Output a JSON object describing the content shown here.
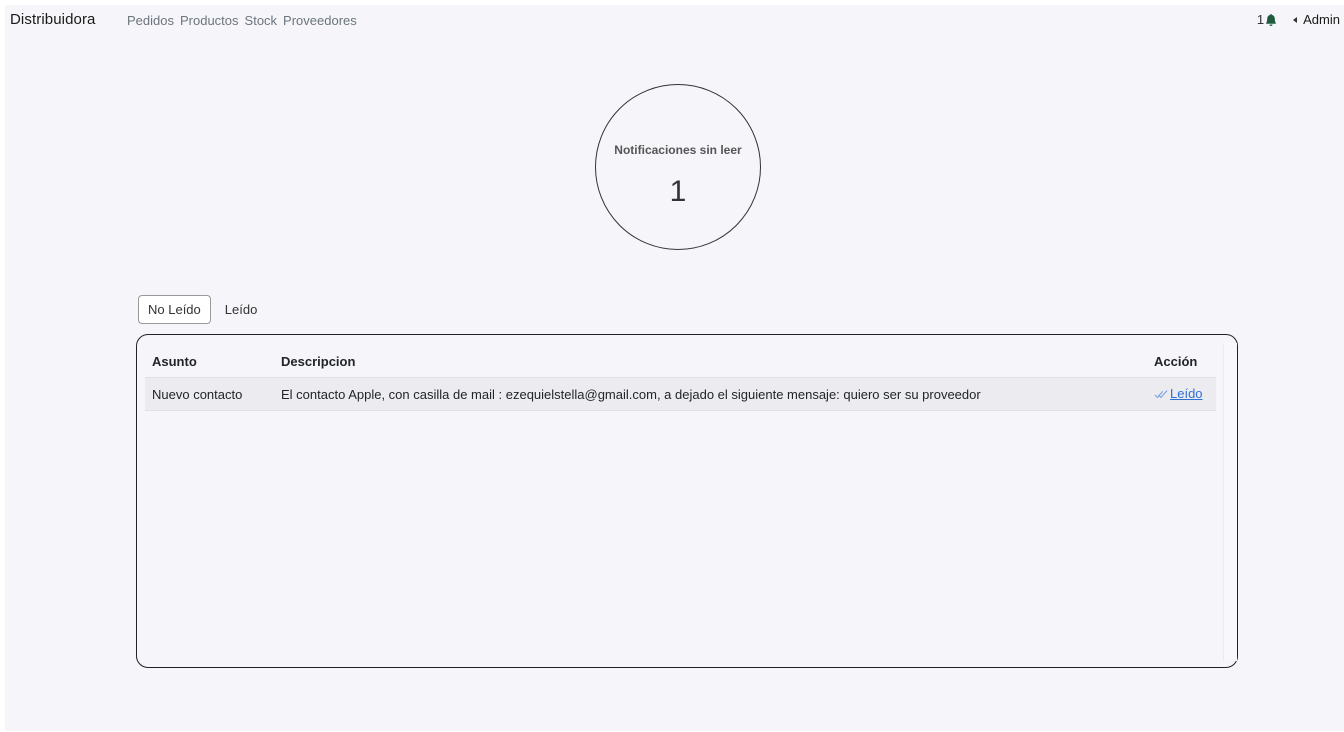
{
  "navbar": {
    "brand": "Distribuidora",
    "links": [
      "Pedidos",
      "Productos",
      "Stock",
      "Proveedores"
    ],
    "notification_count": "1",
    "notification_icon": "bell-icon",
    "user_label": "Admin"
  },
  "counter": {
    "title": "Notificaciones sin leer",
    "value": "1"
  },
  "tabs": [
    {
      "label": "No Leído",
      "active": true
    },
    {
      "label": "Leído",
      "active": false
    }
  ],
  "table": {
    "headers": [
      "Asunto",
      "Descripcion",
      "Acción"
    ],
    "rows": [
      {
        "asunto": "Nuevo contacto",
        "descripcion": "El contacto Apple, con casilla de mail : ezequielstella@gmail.com, a dejado el siguiente mensaje: quiero ser su proveedor",
        "accion": "Leído",
        "accion_icon": "check-icon"
      }
    ]
  },
  "colors": {
    "background": "#f5f5fa",
    "link": "#2f6fd6",
    "bell": "#1f5c3e"
  }
}
